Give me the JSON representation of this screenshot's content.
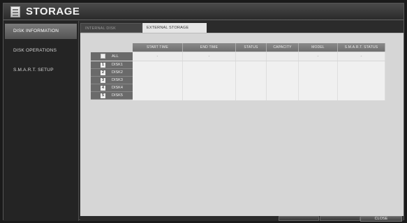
{
  "window": {
    "title": "STORAGE"
  },
  "sidebar": {
    "items": [
      {
        "label": "DISK INFORMATION",
        "active": true
      },
      {
        "label": "DISK OPERATIONS",
        "active": false
      },
      {
        "label": "S.M.A.R.T. SETUP",
        "active": false
      }
    ]
  },
  "tabs": [
    {
      "label": "INTERNAL DISK",
      "active": false
    },
    {
      "label": "EXTERNAL STORAGE",
      "active": true
    }
  ],
  "table": {
    "columns": [
      "START TIME",
      "END TIME",
      "STATUS",
      "CAPACITY",
      "MODEL",
      "S.M.A.R.T. STATUS"
    ],
    "all_row": {
      "label": "ALL",
      "values": [
        "-",
        "-",
        "",
        "",
        "-",
        "-"
      ]
    },
    "disks": [
      {
        "badge": "1",
        "label": "DISK1"
      },
      {
        "badge": "2",
        "label": "DISK2"
      },
      {
        "badge": "3",
        "label": "DISK3"
      },
      {
        "badge": "4",
        "label": "DISK4"
      },
      {
        "badge": "5",
        "label": "DISK5"
      }
    ]
  },
  "footer": {
    "close_label": "CLOSE"
  },
  "colors": {
    "accent": "#e6e6e6",
    "header": "#7a7a7a",
    "background": "#2b2b2b"
  }
}
